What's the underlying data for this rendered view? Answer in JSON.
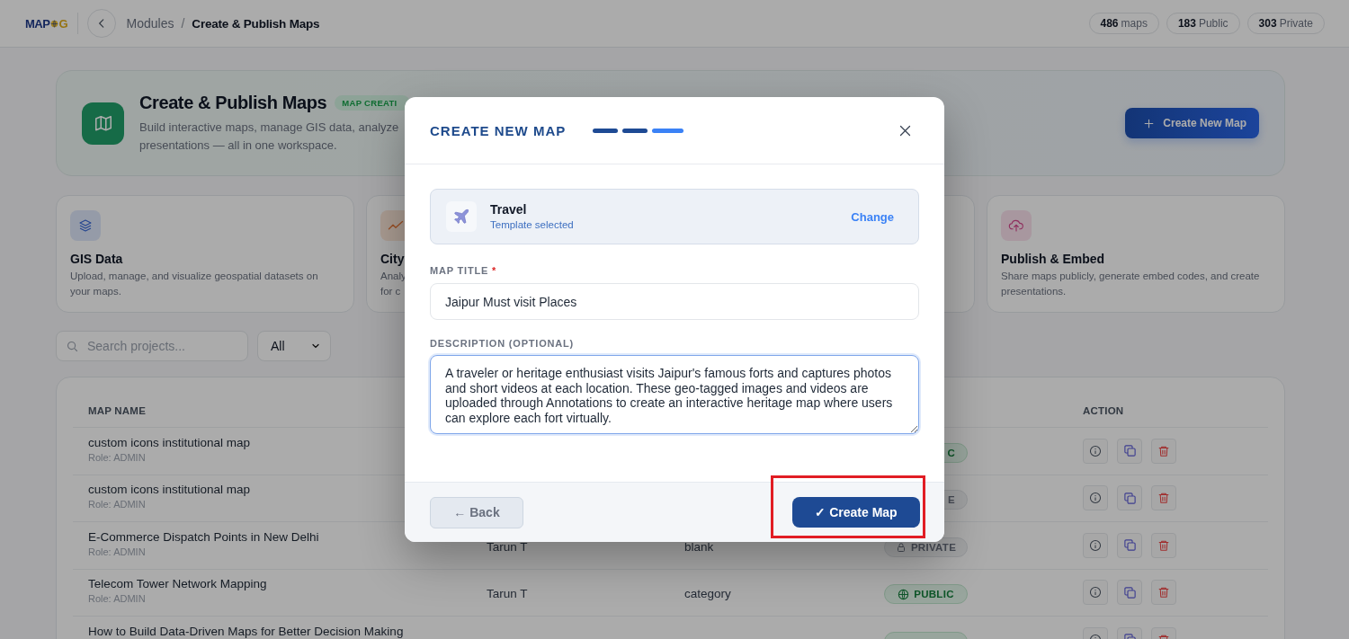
{
  "top_bar": {
    "logo": {
      "lead": "MAP",
      "tail": "G"
    },
    "breadcrumb": [
      {
        "label": "Modules",
        "current": false
      },
      {
        "label": "Create & Publish Maps",
        "current": true
      }
    ],
    "separator": "/",
    "stats": [
      {
        "value": "486",
        "label": "maps"
      },
      {
        "value": "183",
        "label": "Public"
      },
      {
        "value": "303",
        "label": "Private"
      }
    ]
  },
  "header": {
    "title": "Create & Publish Maps",
    "badge": "MAP CREATI",
    "description_lines": [
      "Build interactive maps, manage GIS data, analyze",
      "presentations — all in one workspace."
    ],
    "button": "Create New Map"
  },
  "feature_cards": [
    {
      "kind": "data",
      "title": "GIS Data",
      "description": "Upload, manage, and visualize geospatial datasets on your maps."
    },
    {
      "kind": "analysis",
      "title": "City",
      "description_lines": [
        "Analy",
        "for c"
      ]
    },
    {
      "kind": "covered"
    },
    {
      "kind": "publish",
      "title": "Publish & Embed",
      "description": "Share maps publicly, generate embed codes, and create presentations."
    }
  ],
  "search": {
    "placeholder": "Search projects..."
  },
  "filter": {
    "value": "All"
  },
  "table": {
    "header": {
      "column_1": "MAP NAME",
      "column_5": "ACTION"
    },
    "rows": [
      {
        "name": "custom icons institutional map",
        "role": "Role: ADMIN",
        "visibility": {
          "kind": "public",
          "label": "C",
          "clipped": true
        }
      },
      {
        "name": "custom icons institutional map",
        "role": "Role: ADMIN",
        "visibility": {
          "kind": "private",
          "label": "E",
          "clipped": true
        }
      },
      {
        "name": "E-Commerce Dispatch Points in New Delhi",
        "role": "Role: ADMIN",
        "column_2": "Tarun T",
        "column_3": "blank",
        "visibility": {
          "kind": "private",
          "label": "PRIVATE",
          "clipped": false
        }
      },
      {
        "name": "Telecom Tower Network Mapping",
        "role": "Role: ADMIN",
        "column_2": "Tarun T",
        "column_3": "category",
        "visibility": {
          "kind": "public",
          "label": "PUBLIC",
          "clipped": false
        }
      },
      {
        "name": "How to Build Data-Driven Maps for Better Decision Making",
        "visibility": {
          "kind": "public",
          "clipped": true
        }
      }
    ]
  },
  "modal": {
    "title": "CREATE NEW MAP",
    "steps": [
      {
        "selected": false
      },
      {
        "selected": false
      },
      {
        "selected": true
      }
    ],
    "template": {
      "name": "Travel",
      "status": "Template selected",
      "action": "Change"
    },
    "fields": [
      {
        "kind": "input",
        "label": "MAP TITLE",
        "required_mark": "*",
        "value": "Jaipur Must visit Places",
        "focused": false
      },
      {
        "kind": "textarea",
        "label": "DESCRIPTION (OPTIONAL)",
        "value": "A traveler or heritage enthusiast visits Jaipur's famous forts and captures photos and short videos at each location. These geo-tagged images and videos are uploaded through Annotations to create an interactive heritage map where users can explore each fort virtually.",
        "focused": true
      }
    ],
    "back_button": "← Back",
    "create_button": {
      "label": "✓ Create Map",
      "highlighted": true
    }
  }
}
